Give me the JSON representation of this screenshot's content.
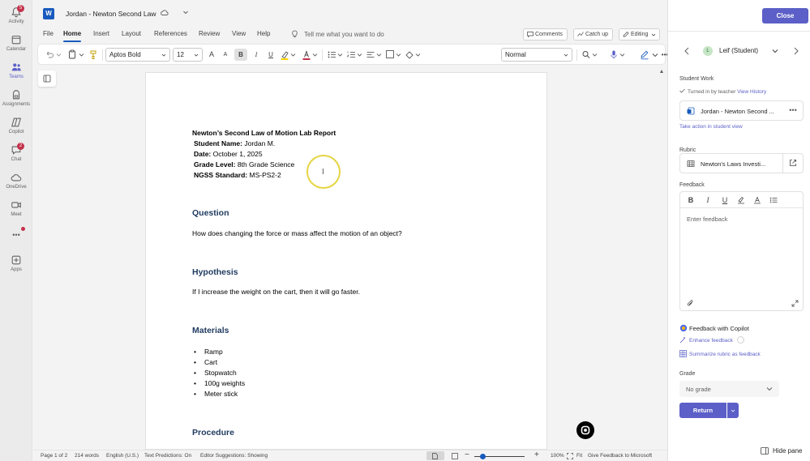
{
  "rail": {
    "items": [
      {
        "label": "Activity",
        "badge": "5"
      },
      {
        "label": "Calendar"
      },
      {
        "label": "Teams"
      },
      {
        "label": "Assignments"
      },
      {
        "label": "Copilot"
      },
      {
        "label": "Chat",
        "badge": "2"
      },
      {
        "label": "OneDrive"
      },
      {
        "label": "Meet"
      },
      {
        "label": "Apps"
      }
    ],
    "more": "•••"
  },
  "word": {
    "logo": "W",
    "title": "Jordan - Newton Second Law",
    "menu": [
      "File",
      "Home",
      "Insert",
      "Layout",
      "References",
      "Review",
      "View",
      "Help"
    ],
    "tell_me": "Tell me what you want to do",
    "comments": "Comments",
    "catch_up": "Catch up",
    "editing": "Editing",
    "ribbon": {
      "font": "Aptos Bold",
      "size": "12",
      "grow": "A",
      "shrink": "A",
      "bold": "B",
      "italic": "I",
      "underline": "U",
      "style": "Normal",
      "more": "•••"
    },
    "document": {
      "title_line": "Newton’s Second Law of Motion Lab Report",
      "fields": [
        {
          "label": "Student Name:",
          "value": "Jordan M."
        },
        {
          "label": "Date:",
          "value": "October 1, 2025"
        },
        {
          "label": "Grade Level:",
          "value": "8th Grade Science"
        },
        {
          "label": "NGSS Standard:",
          "value": "MS-PS2-2"
        }
      ],
      "question_heading": "Question",
      "question_text": "How does changing the force or mass affect the motion of an object?",
      "hypothesis_heading": "Hypothesis",
      "hypothesis_text": "If I increase the weight on the cart, then it will go faster.",
      "materials_heading": "Materials",
      "materials": [
        "Ramp",
        "Cart",
        "Stopwatch",
        "100g weights",
        "Meter stick"
      ],
      "procedure_heading": "Procedure"
    },
    "status": {
      "page": "Page 1 of 2",
      "words": "214 words",
      "language": "English (U.S.)",
      "predictions": "Text Predictions: On",
      "editor": "Editor Suggestions: Showing",
      "zoom": "100%",
      "fit": "Fit",
      "feedback": "Give Feedback to Microsoft",
      "minus": "−",
      "plus": "+"
    }
  },
  "panel": {
    "close": "Close",
    "student_initial": "L",
    "student": "Leif (Student)",
    "student_work_label": "Student Work",
    "turned_in": "Turned in by teacher",
    "view_history": "View History",
    "work_file": "Jordan - Newton Second ...",
    "take_action": "Take action in student view",
    "rubric_label": "Rubric",
    "rubric_name": "Newton's Laws Investi...",
    "feedback_label": "Feedback",
    "feedback_placeholder": "Enter feedback",
    "fb_bold": "B",
    "fb_italic": "I",
    "fb_underline": "U",
    "copilot_title": "Feedback with Copilot",
    "enhance": "Enhance feedback",
    "summarize": "Summarize rubric as feedback",
    "grade_label": "Grade",
    "grade_value": "No grade",
    "return": "Return",
    "hide_pane": "Hide pane",
    "more": "•••"
  },
  "colors": {
    "accent": "#5b5fc7",
    "word_blue": "#185abd",
    "heading": "#1f3a5f",
    "badge": "#c4314b"
  }
}
